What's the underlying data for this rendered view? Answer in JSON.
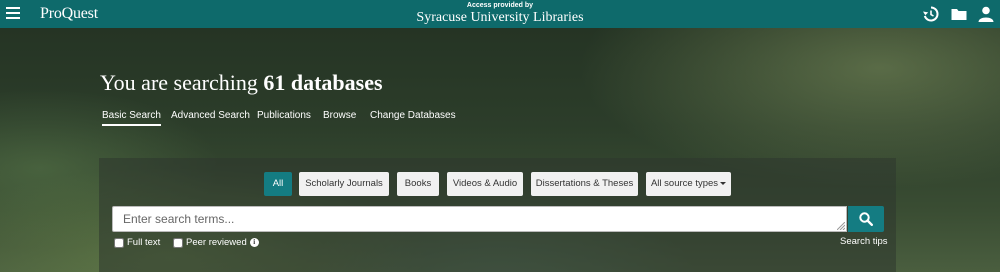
{
  "topbar": {
    "logo": "ProQuest",
    "access_label": "Access provided by",
    "library_name": "Syracuse University Libraries",
    "icons": [
      "menu-icon",
      "history-icon",
      "folder-icon",
      "user-icon"
    ]
  },
  "hero": {
    "heading_prefix": "You are searching",
    "heading_count": "61 databases"
  },
  "nav": {
    "tabs": [
      {
        "label": "Basic Search",
        "active": true
      },
      {
        "label": "Advanced Search",
        "active": false
      },
      {
        "label": "Publications",
        "active": false
      },
      {
        "label": "Browse",
        "active": false
      },
      {
        "label": "Change Databases",
        "active": false
      }
    ]
  },
  "filters": {
    "items": [
      {
        "label": "All",
        "selected": true
      },
      {
        "label": "Scholarly Journals",
        "selected": false
      },
      {
        "label": "Books",
        "selected": false
      },
      {
        "label": "Videos & Audio",
        "selected": false
      },
      {
        "label": "Dissertations & Theses",
        "selected": false
      },
      {
        "label": "All source types",
        "selected": false
      }
    ]
  },
  "search": {
    "placeholder": "Enter search terms...",
    "value": "",
    "full_text_label": "Full text",
    "peer_reviewed_label": "Peer reviewed",
    "tips_label": "Search tips"
  },
  "colors": {
    "topbar": "#0e6a6b",
    "accent": "#147c82"
  }
}
